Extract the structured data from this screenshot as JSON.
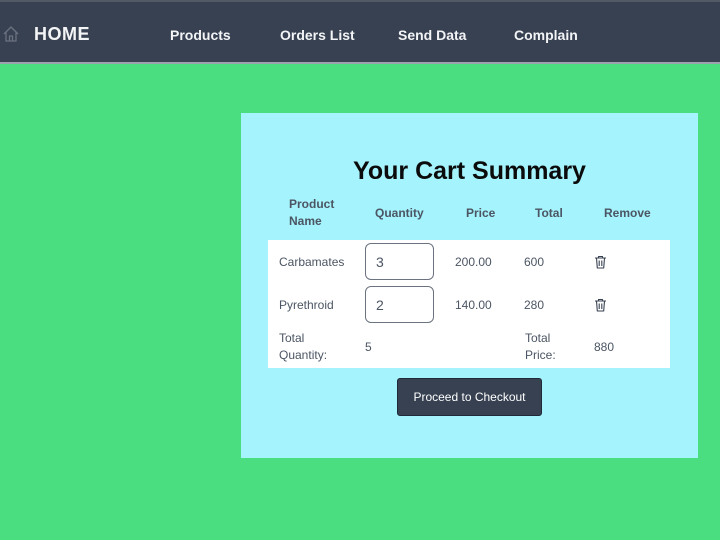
{
  "navbar": {
    "home_icon": "home-icon",
    "home_label": "HOME",
    "links": [
      "Products",
      "Orders List",
      "Send Data",
      "Complain"
    ]
  },
  "cart": {
    "title": "Your Cart Summary",
    "headers": {
      "product_name": "Product\nName",
      "quantity": "Quantity",
      "price": "Price",
      "total": "Total",
      "remove": "Remove"
    },
    "rows": [
      {
        "name": "Carbamates",
        "quantity": "3",
        "price": "200.00",
        "total": "600",
        "remove_icon": "trash-icon"
      },
      {
        "name": "Pyrethroid",
        "quantity": "2",
        "price": "140.00",
        "total": "280",
        "remove_icon": "trash-icon"
      }
    ],
    "summary": {
      "total_quantity_label": "Total\nQuantity:",
      "total_quantity": "5",
      "total_price_label": "Total\nPrice:",
      "total_price": "880"
    },
    "checkout_label": "Proceed to Checkout"
  },
  "colors": {
    "page_background": "#4ade80",
    "navbar_background": "#374151",
    "card_background": "#a5f3fc",
    "button_background": "#374151"
  }
}
